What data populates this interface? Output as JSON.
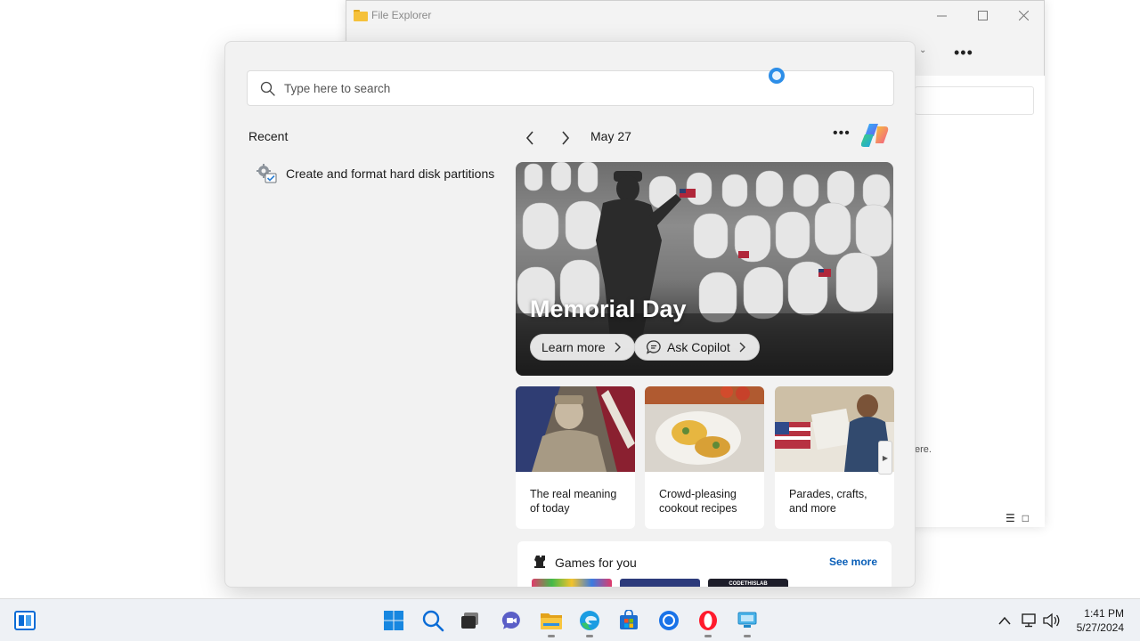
{
  "file_explorer": {
    "title": "File Explorer",
    "more_label": "•••",
    "partial_text": "ere."
  },
  "search": {
    "placeholder": "Type here to search"
  },
  "recent": {
    "title": "Recent",
    "items": [
      {
        "label": "Create and format hard disk partitions",
        "icon": "disk-management-icon"
      }
    ]
  },
  "highlights": {
    "date": "May 27",
    "more_label": "•••",
    "hero": {
      "title": "Memorial Day",
      "learn_more": "Learn more",
      "ask_copilot": "Ask Copilot"
    },
    "cards": [
      {
        "text": "The real meaning of today"
      },
      {
        "text": "Crowd-pleasing cookout recipes"
      },
      {
        "text": "Parades, crafts, and more"
      }
    ]
  },
  "games": {
    "title": "Games for you",
    "see_more": "See more",
    "thumb_caption": "CODETHISLAB"
  },
  "taskbar": {
    "apps": [
      "start-icon",
      "search-icon",
      "task-view-icon",
      "teams-chat-icon",
      "file-explorer-icon",
      "edge-icon",
      "store-icon",
      "chrome-icon",
      "opera-icon",
      "remote-desktop-icon"
    ],
    "time": "1:41 PM",
    "date": "5/27/2024"
  },
  "colors": {
    "accent": "#0a5fb8",
    "busy_ring": "#2d8ee8",
    "flyout_bg": "#f2f2f2",
    "taskbar_bg": "#eef1f5"
  }
}
